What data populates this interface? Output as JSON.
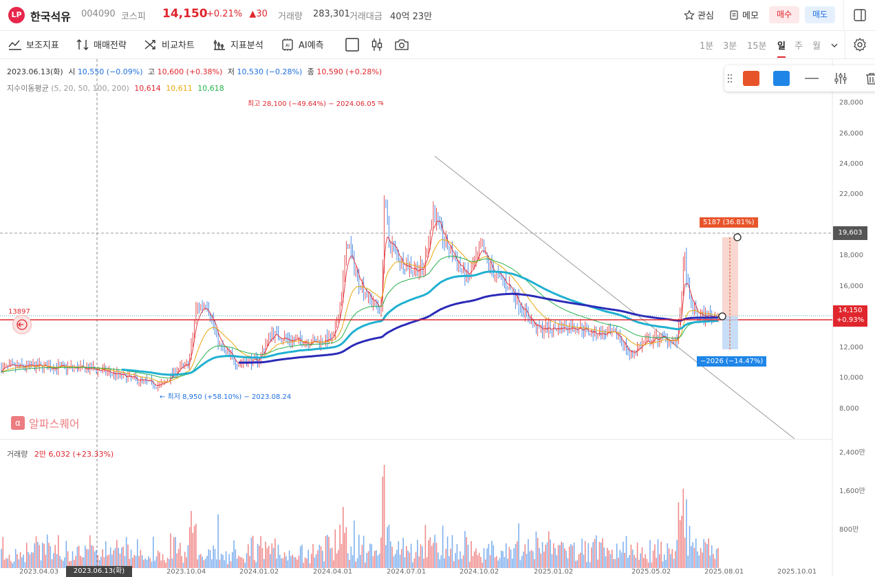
{
  "header": {
    "logo_text": "LP",
    "stock_name": "한국석유",
    "stock_code": "004090",
    "market": "코스피",
    "price": "14,150",
    "change_pct": "+0.21%",
    "change_abs": "▲30",
    "volume_label": "거래량",
    "volume": "283,301",
    "amount_label": "거래대금",
    "amount": "40억 23만",
    "watch_label": "관심",
    "memo_label": "메모",
    "buy_label": "매수",
    "sell_label": "매도"
  },
  "toolbar": {
    "items": [
      "보조지표",
      "매매전략",
      "비교차트",
      "지표분석",
      "AI예측"
    ],
    "periods": [
      "1분",
      "3분",
      "15분",
      "일",
      "주",
      "월"
    ],
    "active_period": "일"
  },
  "info": {
    "date": "2023.06.13(화)",
    "open_label": "시",
    "open": "10,550 (−0.09%)",
    "high_label": "고",
    "high": "10,600 (+0.38%)",
    "low_label": "저",
    "low": "10,530 (−0.28%)",
    "close_label": "종",
    "close": "10,590 (+0.28%)",
    "ma_label": "지수이동평균",
    "ma_params": "(5, 20, 50, 100, 200)",
    "ma_v1": "10,614",
    "ma_v2": "10,611",
    "ma_v3": "10,618"
  },
  "annotations": {
    "max_label": "최고 28,100 (−49.64%) − 2024.06.05 →",
    "min_label": "← 최저 8,950 (+58.10%) − 2023.08.24",
    "target_up": "5187 (36.81%)",
    "target_down": "−2026 (−14.47%)",
    "left_price": "13897",
    "watermark": "알파스퀘어"
  },
  "axis": {
    "price_ticks": [
      "28,000",
      "26,000",
      "24,000",
      "22,000",
      "18,000",
      "16,000",
      "12,000",
      "10,000",
      "8,000"
    ],
    "current_price": "14,150",
    "current_pct": "+0.93%",
    "target_price": "19,603",
    "volume_ticks": [
      "2,400만",
      "1,600만",
      "800만"
    ],
    "x_ticks": [
      "2023.04.03",
      "2023.10.04",
      "2024.01.02",
      "2024.04.01",
      "2024.07.01",
      "2024.10.02",
      "2025.01.02",
      "2025.05.02",
      "2025.08.01",
      "2025.10.01"
    ],
    "crosshair_date": "2023.06.13(화)"
  },
  "volume": {
    "label": "거래량",
    "value": "2만 6,032 (+23.33%)"
  },
  "colors": {
    "up": "#e0262d",
    "down": "#1f6fe0",
    "ma5": "#e0262d",
    "ma20": "#e7a70c",
    "ma50": "#24b04a",
    "ma100": "#1fb0d0",
    "ma200": "#2a2ab8",
    "swatch1": "#e8542a",
    "swatch2": "#1f86e8"
  },
  "icons": [
    "gear-icon",
    "camera-icon",
    "candle-icon",
    "square-icon",
    "star-icon",
    "memo-icon",
    "layout-icon",
    "chevron-down-icon",
    "handle-icon",
    "trash-icon",
    "sliders-icon",
    "line-icon"
  ]
}
